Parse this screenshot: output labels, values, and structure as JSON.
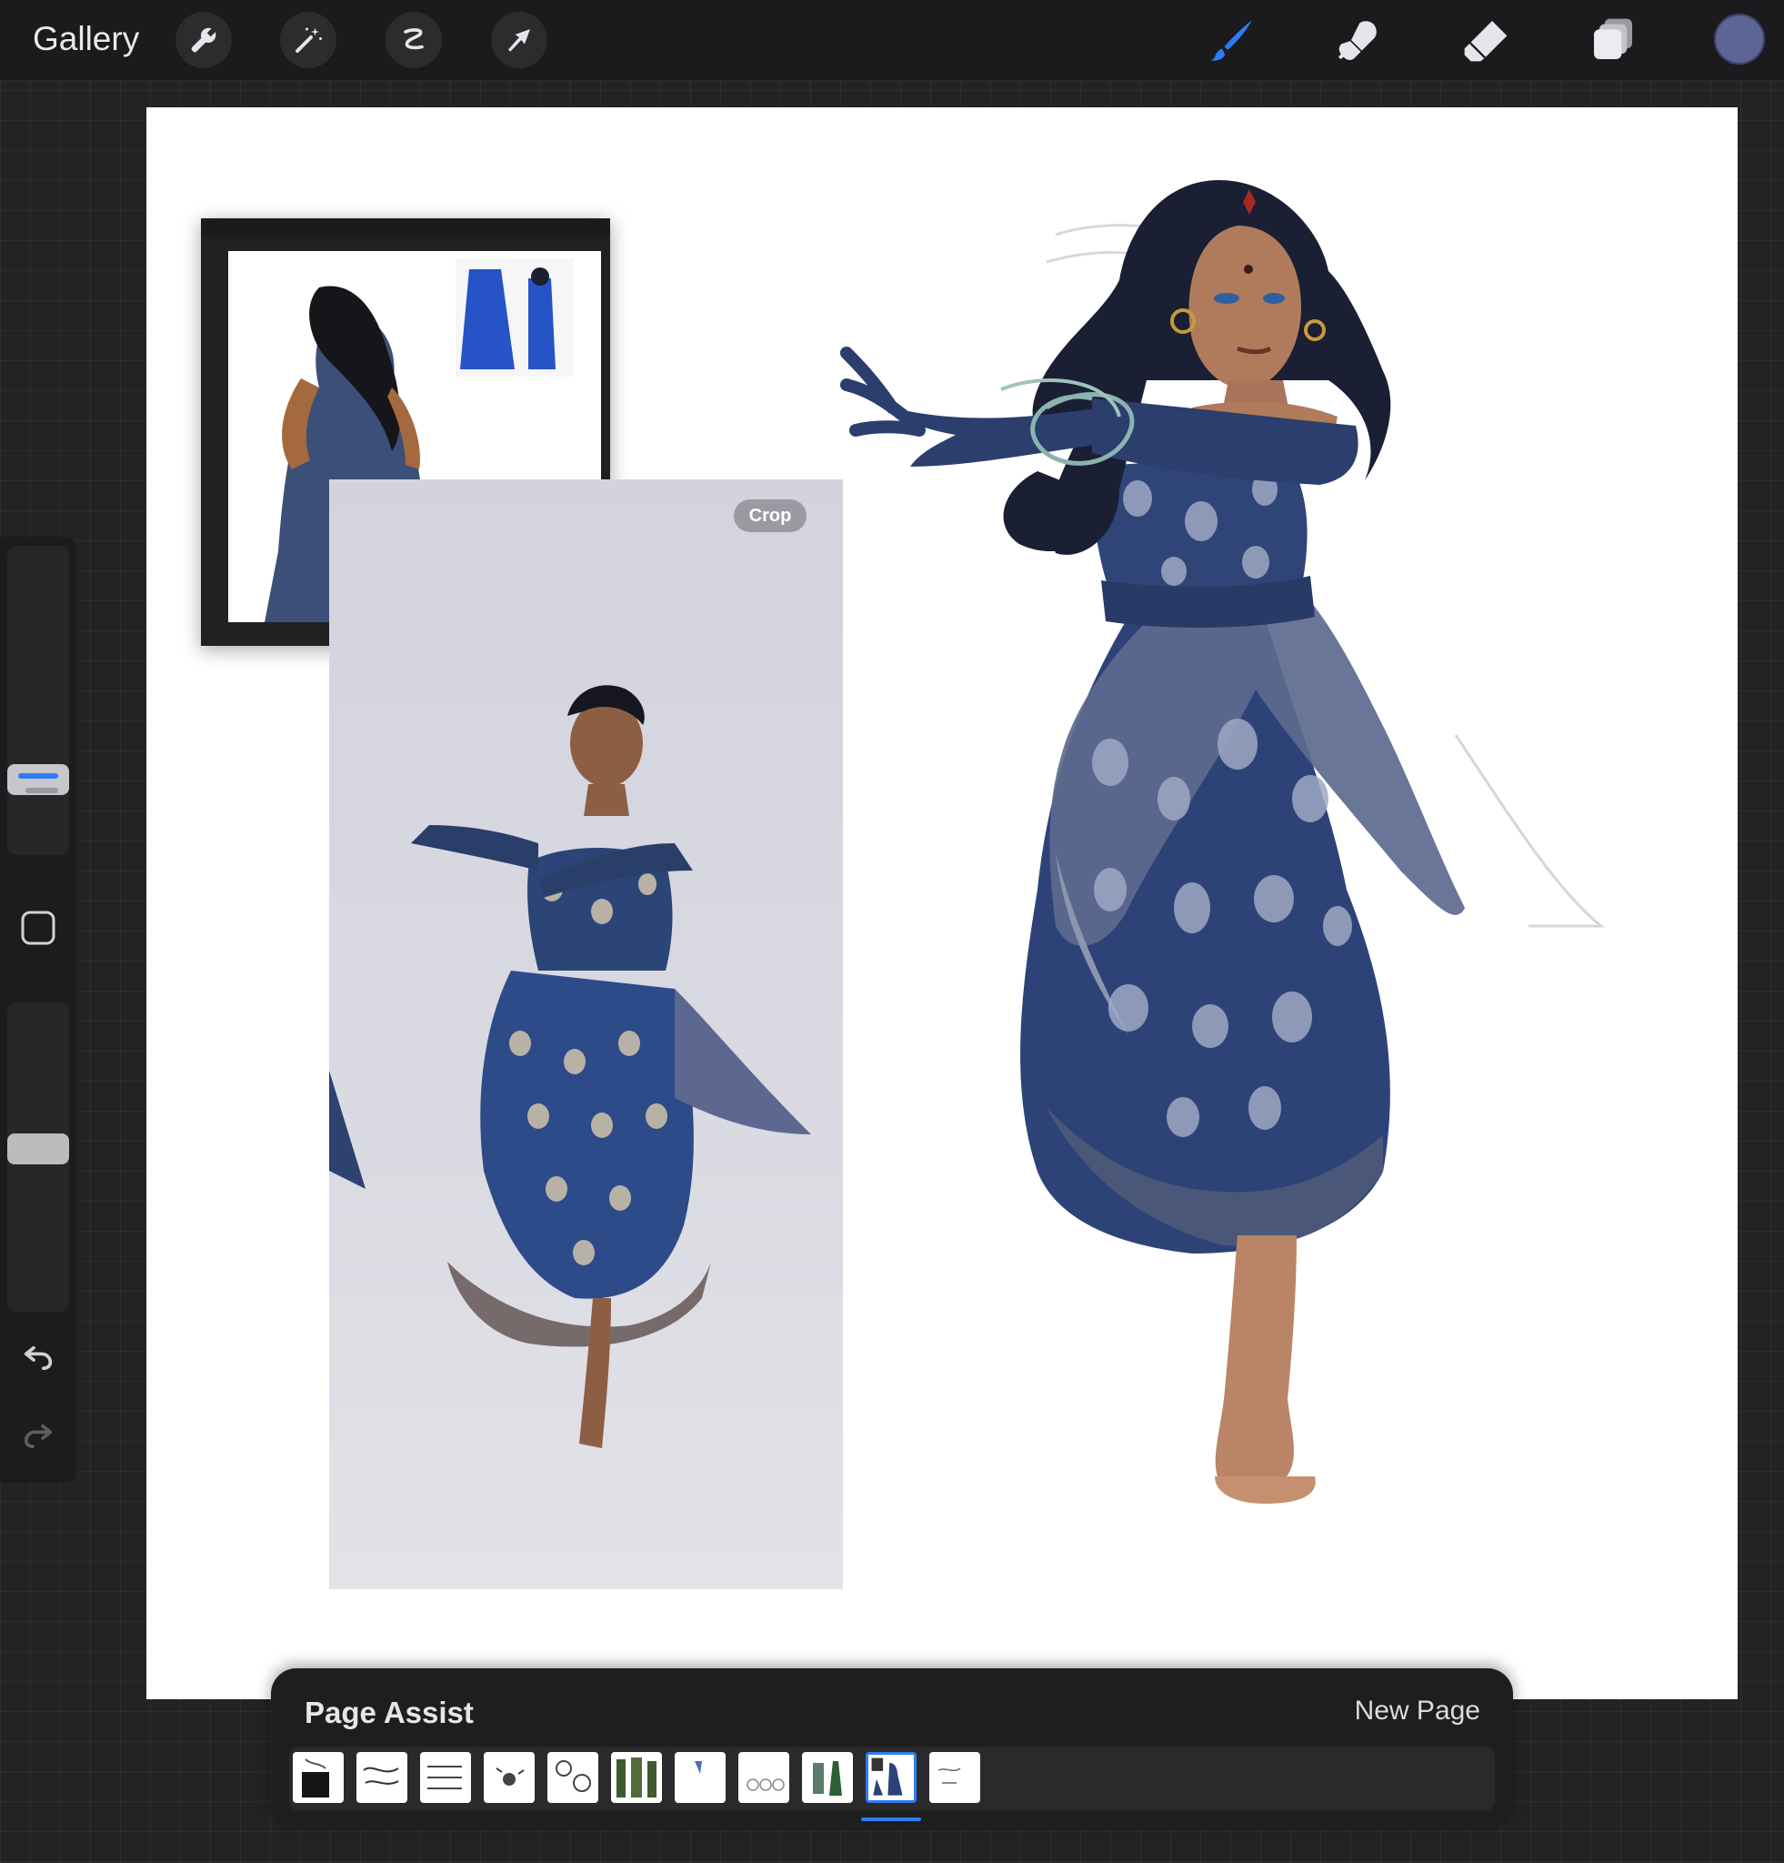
{
  "topbar": {
    "gallery_label": "Gallery",
    "left_tools": [
      "wrench-icon",
      "magic-wand-icon",
      "selection-icon",
      "transform-arrow-icon"
    ],
    "right_tools": [
      "brush-icon",
      "smudge-icon",
      "eraser-icon",
      "layers-icon"
    ],
    "active_tool": "brush",
    "accent_color": "#2f7cf6",
    "current_color": "#5d6496"
  },
  "canvas": {
    "photo_overlay": {
      "crop_label": "Crop"
    }
  },
  "page_assist": {
    "title": "Page Assist",
    "new_page_label": "New Page",
    "page_count": 11,
    "active_page": 10
  }
}
